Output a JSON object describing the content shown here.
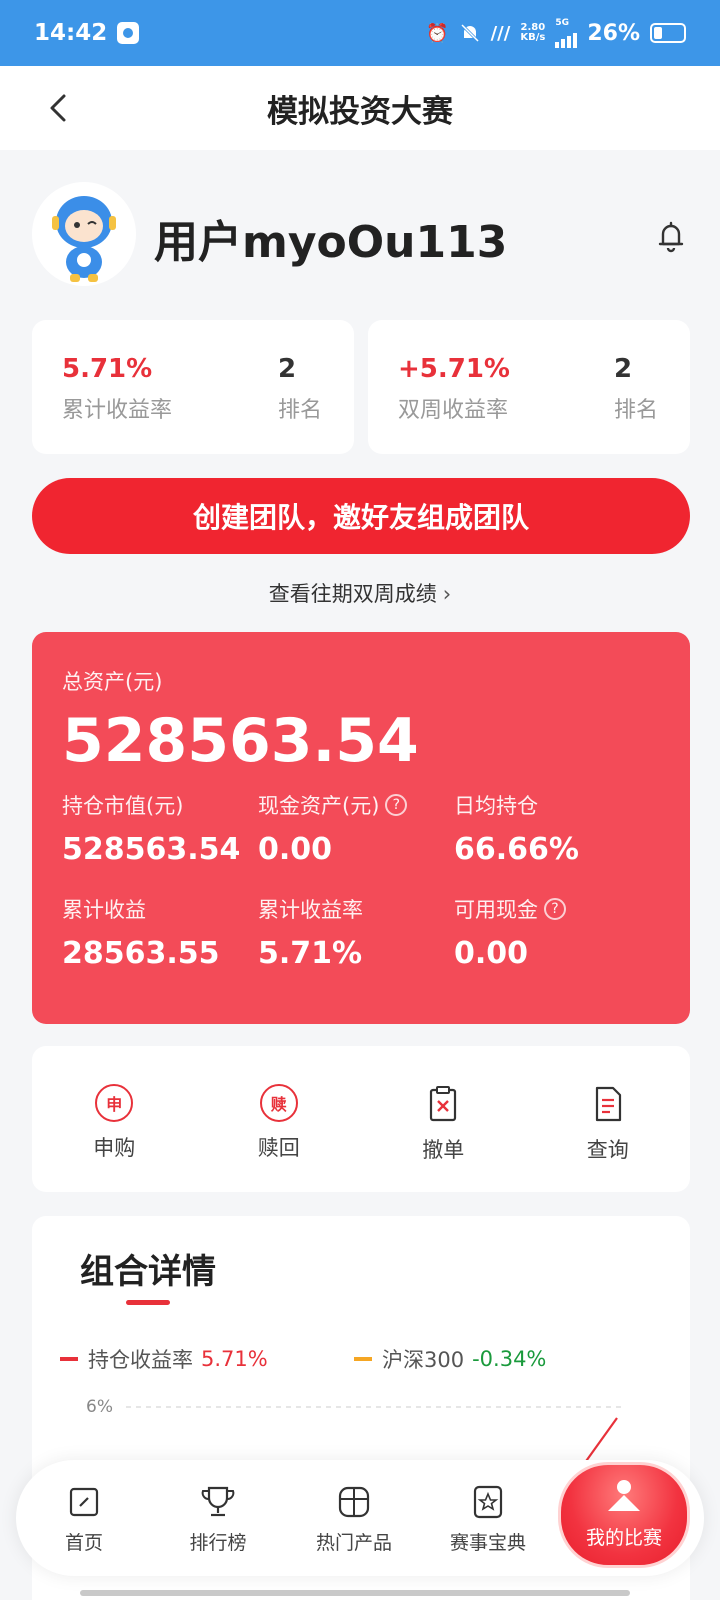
{
  "status_bar": {
    "time": "14:42",
    "net_speed_top": "2.80",
    "net_speed_bottom": "KB/s",
    "network_type": "5G",
    "battery": "26%"
  },
  "nav": {
    "title": "模拟投资大赛"
  },
  "user": {
    "name": "用户myoOu113"
  },
  "stats": [
    {
      "value": "5.71%",
      "label": "累计收益率",
      "rank": "2",
      "rank_label": "排名"
    },
    {
      "value": "+5.71%",
      "label": "双周收益率",
      "rank": "2",
      "rank_label": "排名"
    }
  ],
  "team_button": "创建团队，邀好友组成团队",
  "history_link": "查看往期双周成绩",
  "assets": {
    "total_label": "总资产(元)",
    "total_value": "528563.54",
    "metrics": [
      {
        "label": "持仓市值(元)",
        "value": "528563.54"
      },
      {
        "label": "现金资产(元)",
        "value": "0.00"
      },
      {
        "label": "日均持仓",
        "value": "66.66%"
      },
      {
        "label": "累计收益",
        "value": "28563.55"
      },
      {
        "label": "累计收益率",
        "value": "5.71%"
      },
      {
        "label": "可用现金",
        "value": "0.00"
      }
    ]
  },
  "actions": [
    {
      "label": "申购",
      "glyph": "申"
    },
    {
      "label": "赎回",
      "glyph": "赎"
    },
    {
      "label": "撤单"
    },
    {
      "label": "查询"
    }
  ],
  "details": {
    "title": "组合详情",
    "legend": [
      {
        "name": "持仓收益率",
        "value": "5.71%",
        "color": "#e8313a",
        "value_color": "#e8313a"
      },
      {
        "name": "沪深300",
        "value": "-0.34%",
        "color": "#f5a623",
        "value_color": "#1a9a3c"
      }
    ],
    "y_tick_top": "6%"
  },
  "chart_data": {
    "type": "line",
    "y_ticks": [
      "6%"
    ],
    "series": [
      {
        "name": "持仓收益率",
        "color": "#e8313a",
        "values": [
          5.71
        ]
      },
      {
        "name": "沪深300",
        "color": "#f5a623",
        "values": [
          -0.34
        ]
      }
    ]
  },
  "tabbar": [
    {
      "label": "首页",
      "icon": "home-icon"
    },
    {
      "label": "排行榜",
      "icon": "trophy-icon"
    },
    {
      "label": "热门产品",
      "icon": "box-icon"
    },
    {
      "label": "赛事宝典",
      "icon": "star-book-icon"
    },
    {
      "label": "我的比赛",
      "icon": "my-match-icon",
      "active": true
    }
  ]
}
